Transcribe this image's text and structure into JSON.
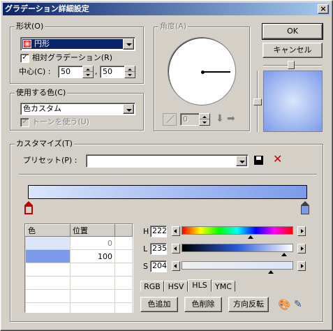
{
  "window": {
    "title": "グラデーション詳細設定",
    "close_glyph": "×"
  },
  "shape_group": {
    "title": "形状(O)",
    "shape_value": "円形",
    "relative_label": "相対グラデーション(R)",
    "relative_checked": "✓",
    "center_label": "中心(C) :",
    "center_x": "50",
    "center_y": "50",
    "comma": ","
  },
  "angle_group": {
    "title": "角度(A)",
    "value": "0"
  },
  "buttons": {
    "ok": "OK",
    "cancel": "キャンセル"
  },
  "color_group": {
    "title": "使用する色(C)",
    "color_mode": "色カスタム",
    "tone_label": "トーンを使う(U)",
    "tone_checked": "✓"
  },
  "customize_group": {
    "title": "カスタマイズ(T)",
    "preset_label": "プリセット(P) :",
    "preset_value": "",
    "table_headers": [
      "色",
      "位置"
    ],
    "rows": [
      {
        "color": "#dbe6fb",
        "position": "0"
      },
      {
        "color": "#7b9bea",
        "position": "100"
      }
    ],
    "hls": {
      "h_label": "H",
      "h_value": "222",
      "l_label": "L",
      "l_value": "235",
      "s_label": "S",
      "s_value": "204",
      "h_fraction": 0.62,
      "l_fraction": 0.92,
      "s_fraction": 0.8
    },
    "tabs": [
      "RGB",
      "HSV",
      "HLS",
      "YMC"
    ],
    "active_tab": "HLS",
    "actions": {
      "add": "色追加",
      "remove": "色削除",
      "reverse": "方向反転"
    }
  },
  "colors": {
    "start": "#dbe6fb",
    "end": "#7b9bea",
    "title_start": "#0a246a",
    "title_end": "#a6caf0"
  }
}
